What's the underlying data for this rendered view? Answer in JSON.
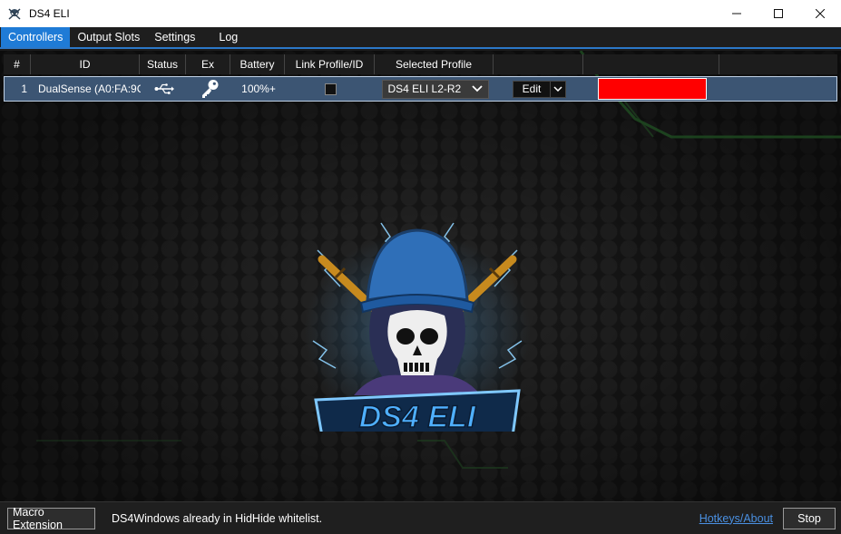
{
  "window": {
    "title": "DS4 ELI"
  },
  "tabs": [
    {
      "label": "Controllers",
      "active": true
    },
    {
      "label": "Output Slots",
      "active": false
    },
    {
      "label": "Settings",
      "active": false
    },
    {
      "label": "Log",
      "active": false
    }
  ],
  "grid": {
    "headers": [
      "#",
      "ID",
      "Status",
      "Ex",
      "Battery",
      "Link Profile/ID",
      "Selected Profile",
      "",
      ""
    ],
    "rows": [
      {
        "index": "1",
        "id": "DualSense (A0:FA:9C",
        "status_icon": "usb-icon",
        "ex_icon": "key-icon",
        "battery": "100%+",
        "link_profile_checked": false,
        "selected_profile": "DS4 ELI L2-R2",
        "edit_label": "Edit",
        "lightbar_color": "#ff0000"
      }
    ]
  },
  "logo": {
    "text": "DS4 ELI"
  },
  "statusbar": {
    "macro_button": "Macro Extension",
    "message": "DS4Windows already in HidHide whitelist.",
    "hotkeys_link": "Hotkeys/About",
    "stop_button": "Stop"
  },
  "colors": {
    "accent": "#1f7bd6",
    "row_bg": "#3c5573",
    "lightbar": "#ff0000",
    "link": "#4a90e2"
  }
}
